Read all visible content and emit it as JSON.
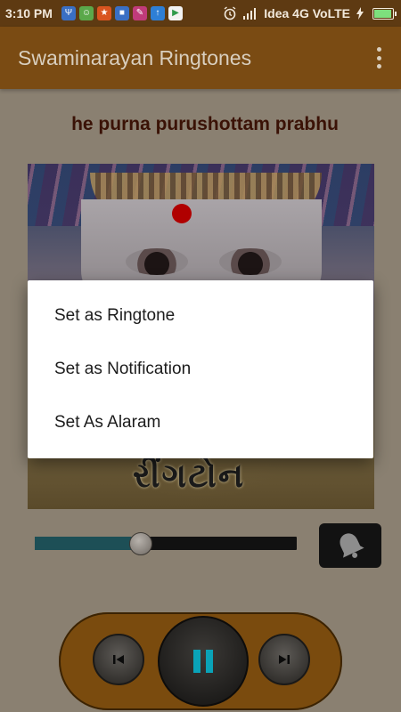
{
  "status_bar": {
    "time": "3:10 PM",
    "notification_icons": [
      "usb-icon",
      "android-icon",
      "app-icon",
      "app-icon",
      "app-icon",
      "upload-icon",
      "play-store-icon"
    ],
    "carrier": "Idea 4G VoLTE",
    "alarm_icon": "alarm-icon",
    "signal_icon": "signal-icon",
    "charging_icon": "charging-bolt-icon",
    "battery_icon": "battery-icon"
  },
  "app_bar": {
    "title": "Swaminarayan Ringtones",
    "menu_icon": "more-vert-icon"
  },
  "now_playing": {
    "song_title": "he purna purushottam prabhu",
    "artwork_caption": "રીંગટોન",
    "progress": 0.4
  },
  "controls": {
    "prev_icon": "skip-previous-icon",
    "pause_icon": "pause-icon",
    "next_icon": "skip-next-icon",
    "bell_icon": "bell-icon"
  },
  "dialog": {
    "items": [
      {
        "label": "Set as Ringtone"
      },
      {
        "label": "Set as Notification"
      },
      {
        "label": "Set As Alaram"
      }
    ]
  },
  "colors": {
    "status_bar": "#5e3a12",
    "app_bar": "#7a4b13",
    "background": "#8a8071",
    "title_text": "#3a1206",
    "seek_progress": "#1d4f56",
    "player_bar": "#7a4b0e",
    "pause_accent": "#0aa3b8"
  }
}
